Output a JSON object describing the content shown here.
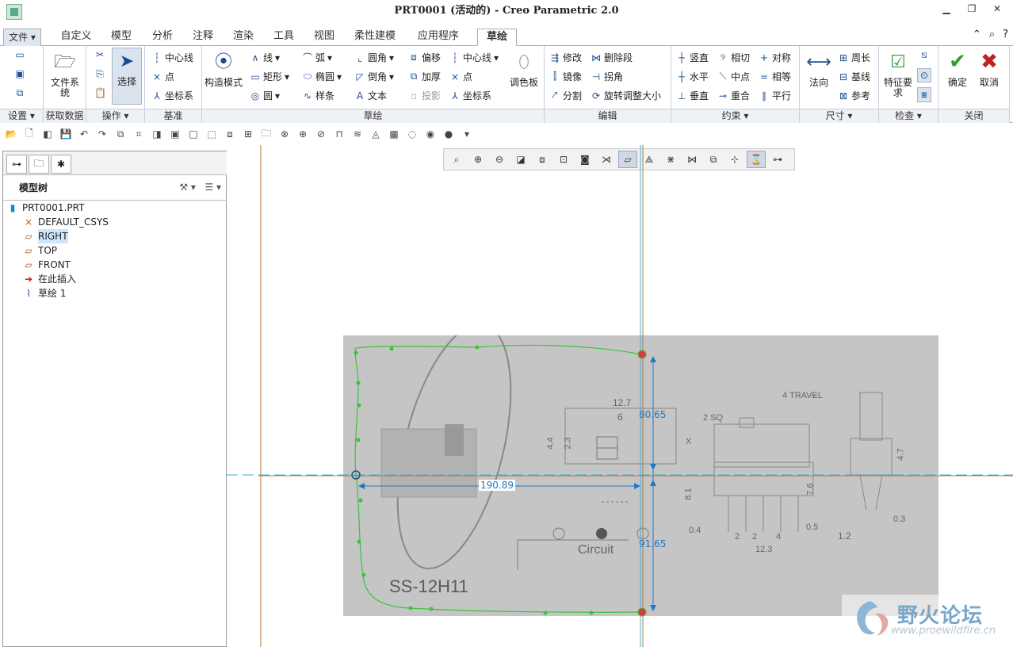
{
  "window": {
    "title": "PRT0001 (活动的) - Creo Parametric 2.0",
    "controls": [
      "▁",
      "❐",
      "✕"
    ]
  },
  "tabs": [
    {
      "label": "文件 ▾"
    },
    {
      "label": "自定义"
    },
    {
      "label": "模型"
    },
    {
      "label": "分析"
    },
    {
      "label": "注释"
    },
    {
      "label": "渲染"
    },
    {
      "label": "工具"
    },
    {
      "label": "视图"
    },
    {
      "label": "柔性建模"
    },
    {
      "label": "应用程序"
    },
    {
      "label": "草绘"
    }
  ],
  "tab_right_icons": [
    "⌃",
    "⌕",
    "?"
  ],
  "ribbon": {
    "setup": {
      "footer": "设置 ▾"
    },
    "get_data": {
      "file_system": "文件系统",
      "footer": "获取数据"
    },
    "operations": {
      "select": "选择",
      "footer": "操作 ▾"
    },
    "datum": {
      "centerline": "中心线",
      "point": "点",
      "csys": "坐标系",
      "footer": "基准"
    },
    "sketch": {
      "construction": "构造模式",
      "line": "线",
      "rect": "矩形",
      "circle": "圆",
      "arc": "弧",
      "ellipse": "椭圆",
      "spline": "样条",
      "fillet": "圆角",
      "chamfer": "倒角",
      "text": "文本",
      "offset": "偏移",
      "thicken": "加厚",
      "project": "投影",
      "centerline": "中心线",
      "point": "点",
      "csys": "坐标系",
      "palette": "调色板",
      "footer": "草绘"
    },
    "edit": {
      "modify": "修改",
      "delete_segment": "删除段",
      "mirror": "镜像",
      "corner": "拐角",
      "divide": "分割",
      "rotate_resize": "旋转调整大小",
      "footer": "编辑"
    },
    "constrain": {
      "vertical": "竖直",
      "tangent": "相切",
      "symmetric": "对称",
      "horizontal": "水平",
      "midpoint": "中点",
      "equal": "相等",
      "perpendicular": "垂直",
      "coincident": "重合",
      "parallel": "平行",
      "footer": "约束 ▾"
    },
    "dimension": {
      "normal": "法向",
      "perimeter": "周长",
      "baseline": "基线",
      "reference": "参考",
      "footer": "尺寸 ▾"
    },
    "inspect": {
      "feature_req": "特征要求",
      "footer": "检查 ▾"
    },
    "close": {
      "ok": "确定",
      "cancel": "取消",
      "footer": "关闭"
    }
  },
  "model_tree": {
    "header": "模型树",
    "items": [
      {
        "label": "PRT0001.PRT",
        "icon": "part-icon"
      },
      {
        "label": "DEFAULT_CSYS",
        "icon": "csys-icon"
      },
      {
        "label": "RIGHT",
        "icon": "datum-plane-icon"
      },
      {
        "label": "TOP",
        "icon": "datum-plane-icon"
      },
      {
        "label": "FRONT",
        "icon": "datum-plane-icon"
      },
      {
        "label": "在此插入",
        "icon": "insert-arrow-icon"
      },
      {
        "label": "草绘 1",
        "icon": "sketch-icon"
      }
    ]
  },
  "sketch": {
    "dimensions": {
      "width": "190.89",
      "top_height": "80.65",
      "bottom_height": "91.65"
    }
  },
  "photo_text": {
    "d1": "12.7",
    "d2": "6",
    "d3": "4.4",
    "d4": "2.3",
    "travel": "4 TRAVEL",
    "sq": "2 SQ",
    "x": "X",
    "d5": "7.6",
    "d6": "8.1",
    "d7": "0.4",
    "d8": "0.5",
    "d9": "2",
    "d10": "2",
    "d11": "4",
    "d12": "12.3",
    "d13": "4.7",
    "d14": "0.3",
    "d15": "1.2",
    "circuit": "Circuit",
    "model": "SS-12H11"
  },
  "watermark": {
    "title": "野火论坛",
    "url": "www.proewildfire.cn"
  }
}
